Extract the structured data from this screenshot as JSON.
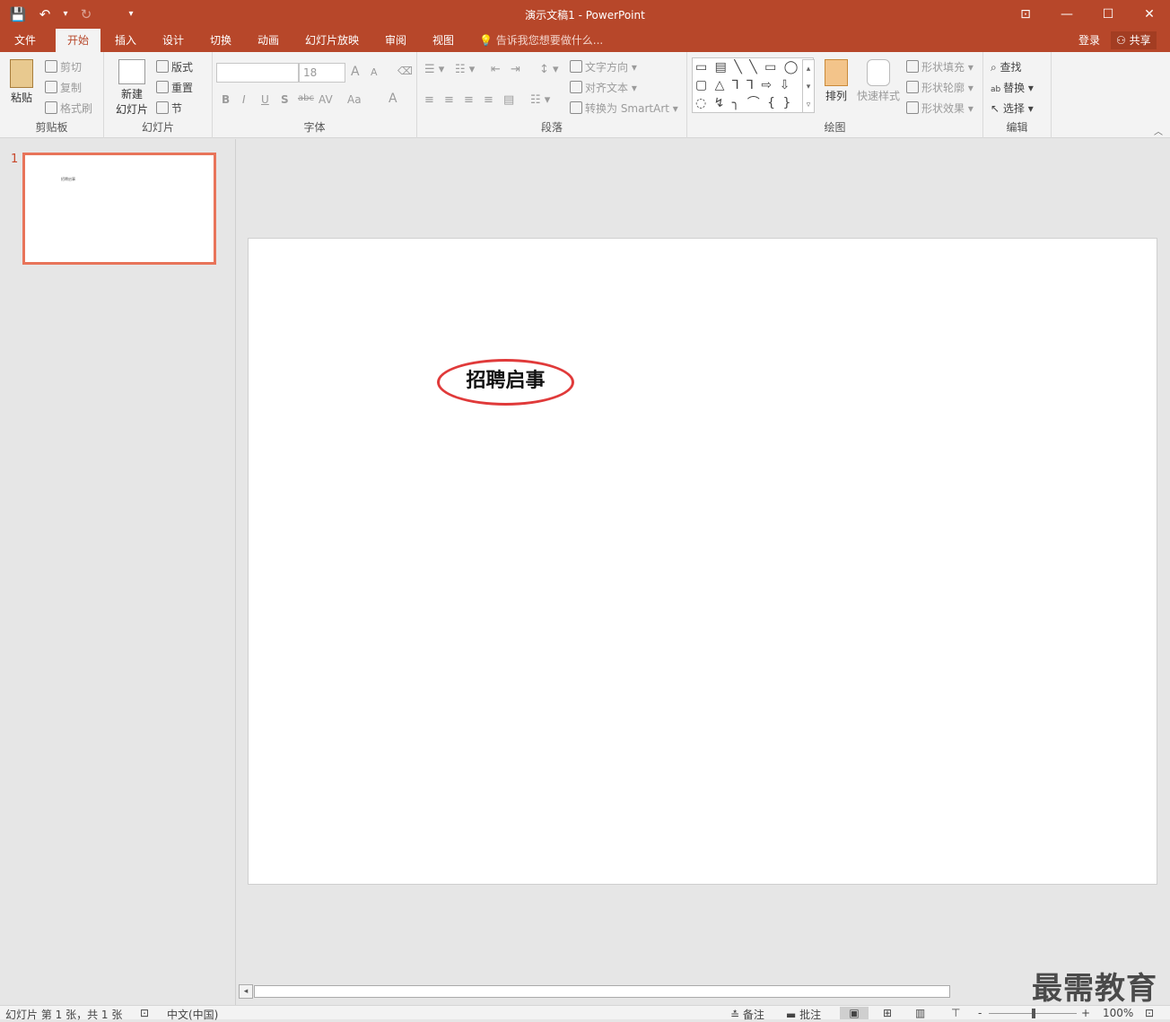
{
  "window": {
    "title": "演示文稿1 - PowerPoint"
  },
  "qat": {
    "save_icon": "💾",
    "undo_icon": "↶",
    "undo_more": "▾",
    "redo_icon": "↻",
    "customize_icon": "▾"
  },
  "window_buttons": {
    "ribbon_display": "⊡",
    "minimize": "—",
    "maximize": "☐",
    "close": "✕"
  },
  "tabs": [
    {
      "label": "文件"
    },
    {
      "label": "开始"
    },
    {
      "label": "插入"
    },
    {
      "label": "设计"
    },
    {
      "label": "切换"
    },
    {
      "label": "动画"
    },
    {
      "label": "幻灯片放映"
    },
    {
      "label": "审阅"
    },
    {
      "label": "视图"
    }
  ],
  "tellme": {
    "placeholder": "告诉我您想要做什么..."
  },
  "account": {
    "login": "登录",
    "share": "共享"
  },
  "ribbon": {
    "clipboard": {
      "label": "剪贴板",
      "paste": "粘贴",
      "cut": "剪切",
      "copy": "复制",
      "format_painter": "格式刷"
    },
    "slides": {
      "label": "幻灯片",
      "new_slide": "新建",
      "new_slide2": "幻灯片",
      "layout": "版式",
      "reset": "重置",
      "section": "节"
    },
    "font": {
      "label": "字体",
      "size": "18",
      "bold": "B",
      "italic": "I",
      "underline": "U",
      "shadow": "S",
      "strike": "abc",
      "spacing": "AV",
      "case": "Aa",
      "grow": "A",
      "shrink": "A",
      "color": "A"
    },
    "paragraph": {
      "label": "段落",
      "text_direction": "文字方向",
      "align_text": "对齐文本",
      "smartart": "转换为 SmartArt"
    },
    "drawing": {
      "label": "绘图",
      "shapes_row1": "▭ ▤ ╲ ╲ ▭ ◯",
      "shapes_row2": "▢ △ ⅂ ⅂ ⇨ ⇩",
      "shapes_row3": "◌ ↯ ╮ ⌒ { }",
      "arrange": "排列",
      "quick_styles": "快速样式",
      "fill": "形状填充",
      "outline": "形状轮廓",
      "effects": "形状效果"
    },
    "editing": {
      "label": "编辑",
      "find": "查找",
      "replace": "替换",
      "select": "选择"
    }
  },
  "thumbs": [
    {
      "number": "1",
      "text": "招聘启事"
    }
  ],
  "slide": {
    "title": "招聘启事"
  },
  "statusbar": {
    "slide_info": "幻灯片 第 1 张，共 1 张",
    "language": "中文(中国)",
    "notes": "备注",
    "comments": "批注",
    "zoom": "100%",
    "zoom_minus": "-",
    "zoom_plus": "+"
  },
  "watermark": {
    "text": "最需教育"
  },
  "colors": {
    "accent": "#b7472a",
    "oval": "#e03a3a",
    "thumb_border": "#e8745a"
  }
}
